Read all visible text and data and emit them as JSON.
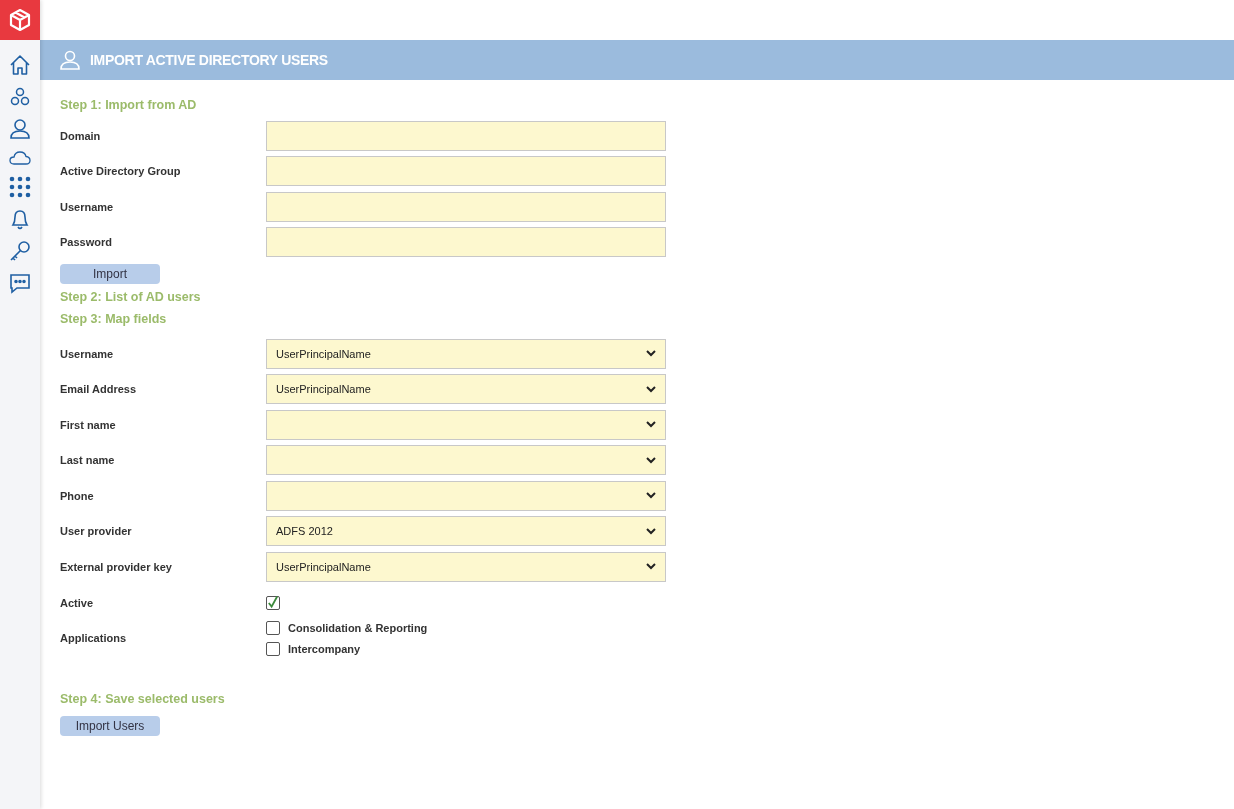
{
  "header": {
    "title": "IMPORT ACTIVE DIRECTORY USERS"
  },
  "step1": {
    "title": "Step 1: Import from AD",
    "fields": [
      {
        "label": "Domain"
      },
      {
        "label": "Active Directory Group"
      },
      {
        "label": "Username"
      },
      {
        "label": "Password"
      }
    ],
    "button": "Import"
  },
  "step2": {
    "title": "Step 2: List of AD users"
  },
  "step3": {
    "title": "Step 3: Map fields",
    "rows": [
      {
        "kind": "select",
        "label": "Username",
        "value": "UserPrincipalName"
      },
      {
        "kind": "select",
        "label": "Email Address",
        "value": "UserPrincipalName"
      },
      {
        "kind": "select",
        "label": "First name"
      },
      {
        "kind": "select",
        "label": "Last name"
      },
      {
        "kind": "select",
        "label": "Phone"
      },
      {
        "kind": "select",
        "label": "User provider",
        "value": "ADFS 2012"
      },
      {
        "kind": "select",
        "label": "External provider key",
        "value": "UserPrincipalName"
      },
      {
        "kind": "checkbox",
        "label": "Active",
        "checked": true
      },
      {
        "kind": "checklist",
        "label": "Applications",
        "options": [
          {
            "label": "Consolidation & Reporting",
            "checked": false
          },
          {
            "label": "Intercompany",
            "checked": false
          }
        ]
      }
    ]
  },
  "step4": {
    "title": "Step 4: Save selected users",
    "button": "Import Users"
  }
}
